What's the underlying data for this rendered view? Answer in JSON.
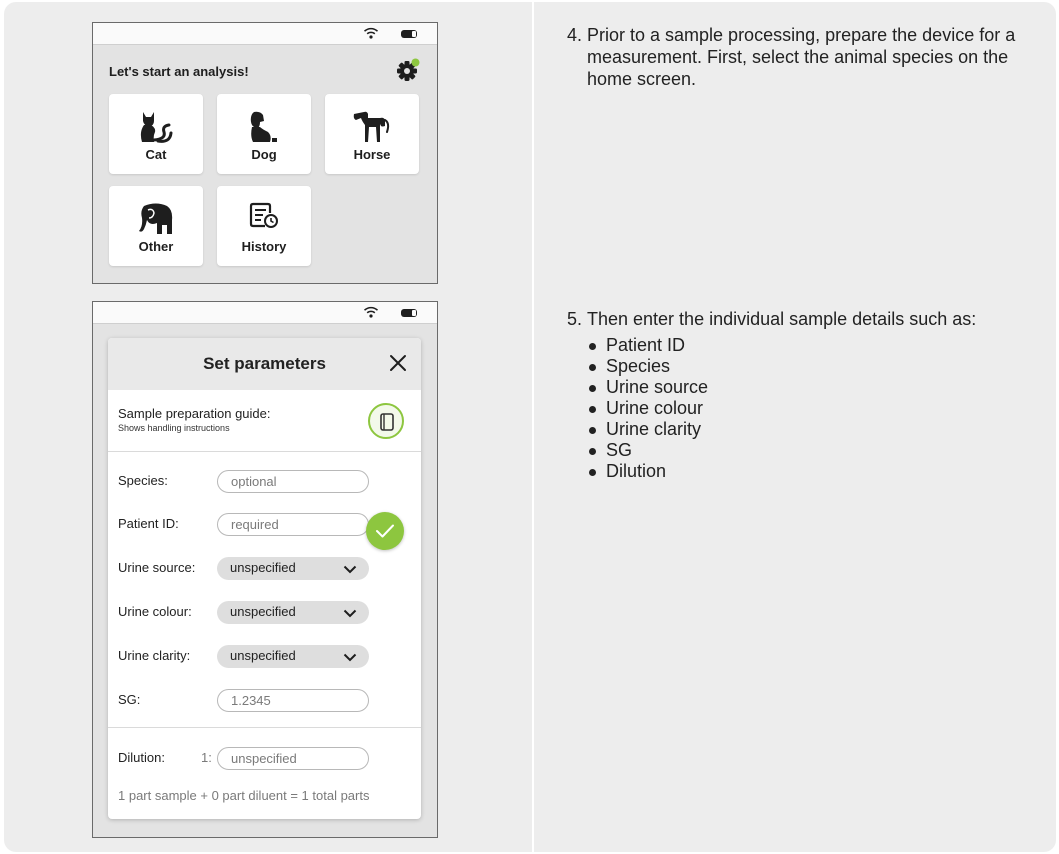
{
  "home_screen": {
    "title": "Let's start an analysis!",
    "tiles": [
      {
        "label": "Cat",
        "icon": "cat-icon"
      },
      {
        "label": "Dog",
        "icon": "dog-icon"
      },
      {
        "label": "Horse",
        "icon": "horse-icon"
      },
      {
        "label": "Other",
        "icon": "elephant-icon"
      },
      {
        "label": "History",
        "icon": "history-icon"
      }
    ],
    "settings_icon": "gear-icon",
    "notification_color": "#8dc63f"
  },
  "parameters_screen": {
    "title": "Set parameters",
    "close_icon": "close-icon",
    "guide_title": "Sample preparation guide:",
    "guide_subtitle": "Shows handling instructions",
    "fields": {
      "species": {
        "label": "Species:",
        "placeholder": "optional"
      },
      "patient_id": {
        "label": "Patient ID:",
        "placeholder": "required"
      },
      "urine_source": {
        "label": "Urine source:",
        "value": "unspecified"
      },
      "urine_colour": {
        "label": "Urine colour:",
        "value": "unspecified"
      },
      "urine_clarity": {
        "label": "Urine clarity:",
        "value": "unspecified"
      },
      "sg": {
        "label": "SG:",
        "placeholder": "1.2345"
      },
      "dilution": {
        "label": "Dilution:",
        "prefix": "1:",
        "placeholder": "unspecified"
      }
    },
    "dilution_summary": "1 part sample + 0 part diluent = 1 total parts"
  },
  "instructions": {
    "step4": {
      "number": "4.",
      "text": "Prior to a sample processing, prepare the device for a measurement. First, select the animal species on the home screen."
    },
    "step5": {
      "number": "5.",
      "text": "Then enter the individual sample details such as:",
      "items": [
        "Patient ID",
        "Species",
        "Urine source",
        "Urine colour",
        "Urine clarity",
        "SG",
        "Dilution"
      ]
    }
  },
  "colors": {
    "accent": "#8dc63f",
    "panel": "#ededed",
    "device_background": "#e3e3e3"
  }
}
